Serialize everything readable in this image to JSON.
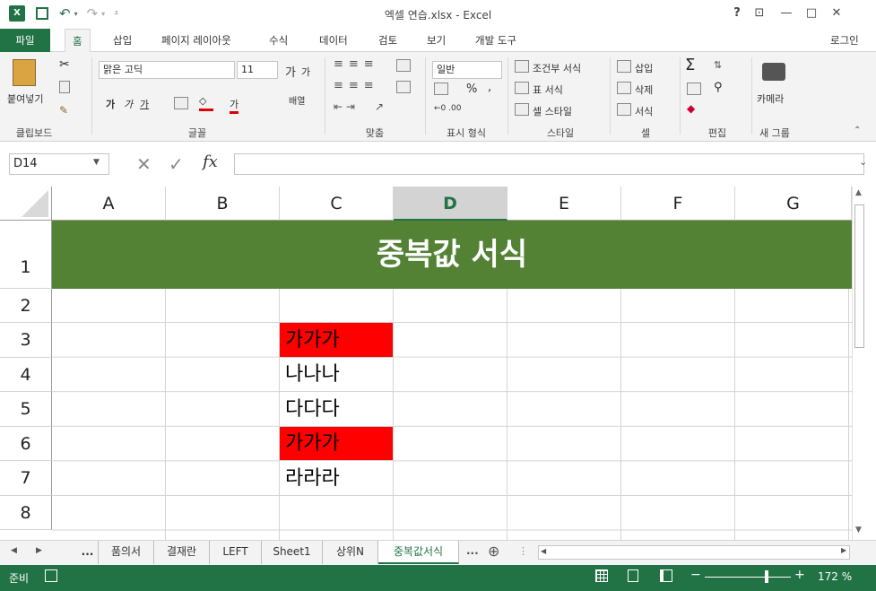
{
  "title": "엑셀 연습.xlsx - Excel",
  "titlebar": {
    "help": "?",
    "restore_ribbon": "⊡",
    "minimize": "—",
    "maximize": "□",
    "close": "✕"
  },
  "tabs": [
    "파일",
    "홈",
    "삽입",
    "페이지 레이아웃",
    "수식",
    "데이터",
    "검토",
    "보기",
    "개발 도구"
  ],
  "login": "로그인",
  "ribbon": {
    "paste": "붙여넣기",
    "font_name": "맑은 고딕",
    "font_size": "11",
    "grow_font": "가",
    "shrink_font": "가",
    "bold": "가",
    "italic": "가",
    "underline": "가",
    "font_color": "가",
    "wrap": "배열",
    "number_format": "일반",
    "percent": "%",
    "comma": ",",
    "cond_format": "조건부 서식",
    "table_format": "표 서식",
    "cell_style": "셀 스타일",
    "insert": "삽입",
    "delete": "삭제",
    "format": "서식",
    "camera": "카메라",
    "groups": {
      "clipboard": "클립보드",
      "font": "글꼴",
      "align": "맞춤",
      "number": "표시 형식",
      "style": "스타일",
      "cells": "셀",
      "edit": "편집",
      "newgroup": "새 그룹"
    }
  },
  "formula_bar": {
    "name_box": "D14",
    "fx": "fx",
    "value": ""
  },
  "columns": [
    "A",
    "B",
    "C",
    "D",
    "E",
    "F",
    "G"
  ],
  "selected_column": "D",
  "rows": [
    "1",
    "2",
    "3",
    "4",
    "5",
    "6",
    "7",
    "8"
  ],
  "banner": "중복값 서식",
  "cells": {
    "C3": "가가가",
    "C4": "나나나",
    "C5": "다다다",
    "C6": "가가가",
    "C7": "라라라"
  },
  "highlight_color": "#ff0000",
  "banner_color": "#548235",
  "sheets": [
    "품의서",
    "결재란",
    "LEFT",
    "Sheet1",
    "상위N",
    "중복값서식"
  ],
  "active_sheet": "중복값서식",
  "sheet_ellipsis": "...",
  "status": {
    "ready": "준비",
    "zoom": "172 %",
    "zoom_level": 0.72
  }
}
